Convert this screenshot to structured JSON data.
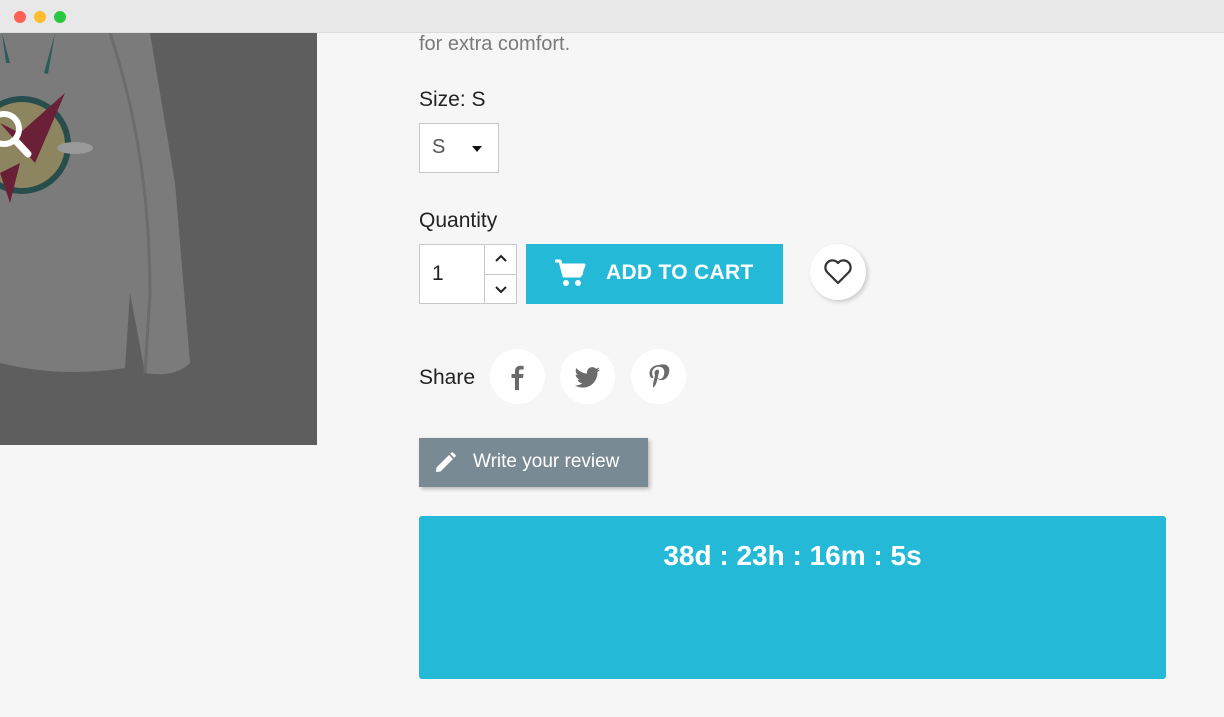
{
  "product": {
    "description_tail": "for extra comfort.",
    "size": {
      "label": "Size: S",
      "selected": "S"
    },
    "quantity": {
      "label": "Quantity",
      "value": "1"
    },
    "add_to_cart_label": "ADD TO CART",
    "share_label": "Share",
    "review_button_label": "Write your review",
    "countdown": "38d : 23h : 16m : 5s"
  },
  "icons": {
    "zoom": "search-icon",
    "cart": "cart-icon",
    "wishlist": "heart-icon",
    "social": [
      "facebook-icon",
      "twitter-icon",
      "pinterest-icon"
    ],
    "review": "pencil-icon"
  },
  "colors": {
    "accent": "#24b9d7",
    "review_button": "#7a8a94",
    "page_background": "#f6f6f6"
  }
}
